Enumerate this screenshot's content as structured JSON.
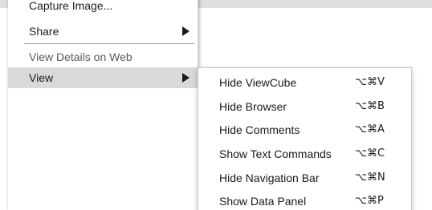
{
  "context_menu": {
    "items": [
      {
        "label": "Capture Image..."
      },
      {
        "label": "Share"
      },
      {
        "label": "View Details on Web"
      },
      {
        "label": "View"
      }
    ]
  },
  "view_submenu": {
    "items": [
      {
        "label": "Hide ViewCube",
        "shortcut": "⌥⌘V"
      },
      {
        "label": "Hide Browser",
        "shortcut": "⌥⌘B"
      },
      {
        "label": "Hide Comments",
        "shortcut": "⌥⌘A"
      },
      {
        "label": "Show Text Commands",
        "shortcut": "⌥⌘C"
      },
      {
        "label": "Hide Navigation Bar",
        "shortcut": "⌥⌘N"
      },
      {
        "label": "Show Data Panel",
        "shortcut": "⌥⌘P"
      }
    ]
  },
  "icons": {
    "share_arrow": "chevron-right-icon",
    "view_arrow": "chevron-right-icon"
  }
}
